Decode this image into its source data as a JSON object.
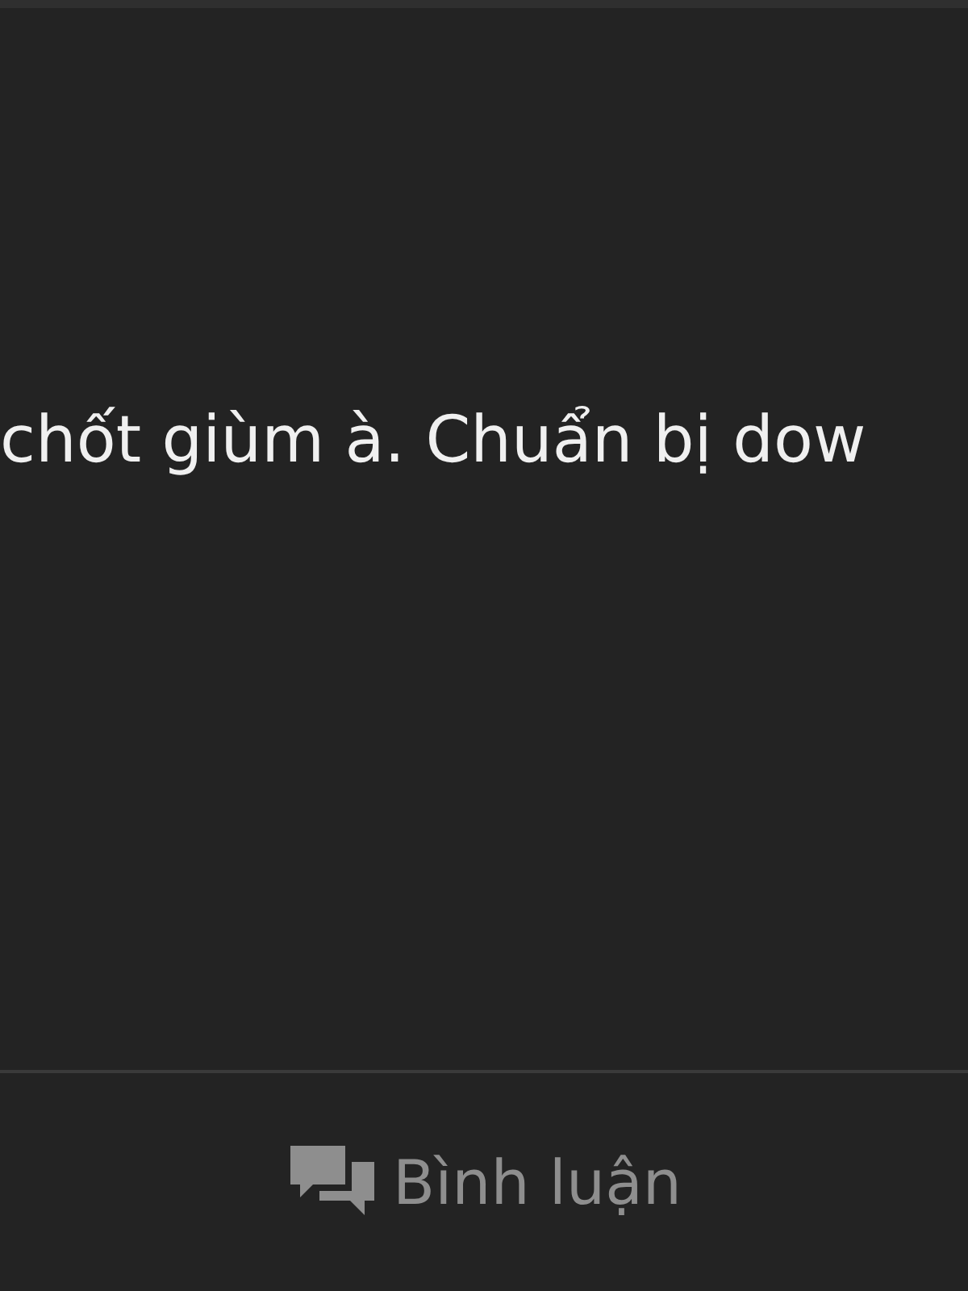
{
  "post": {
    "text": "chốt giùm à. Chuẩn bị dow"
  },
  "footer": {
    "comment_label": "Bình luận"
  }
}
